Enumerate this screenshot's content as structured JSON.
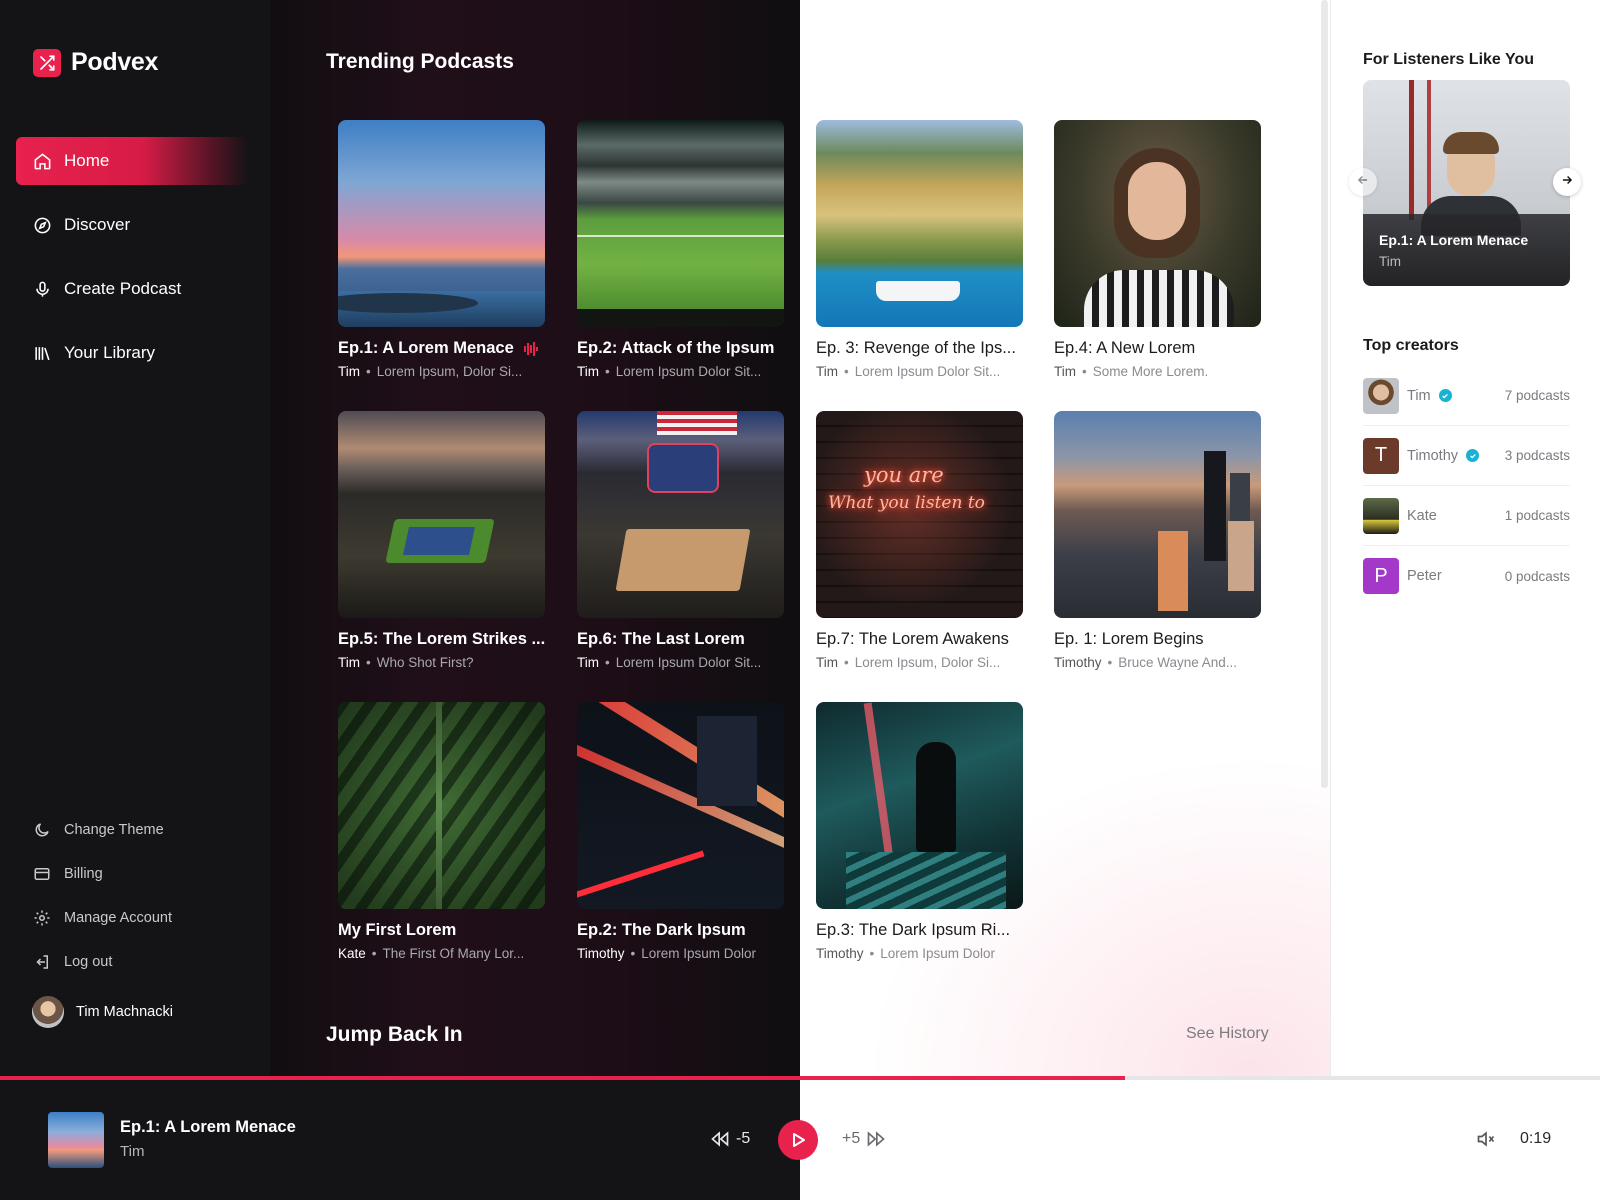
{
  "app": {
    "name": "Podvex"
  },
  "sidebar": {
    "nav": [
      {
        "label": "Home",
        "icon": "home-icon",
        "active": true
      },
      {
        "label": "Discover",
        "icon": "compass-icon",
        "active": false
      },
      {
        "label": "Create Podcast",
        "icon": "microphone-icon",
        "active": false
      },
      {
        "label": "Your Library",
        "icon": "library-icon",
        "active": false
      }
    ],
    "secondary": [
      {
        "label": "Change Theme",
        "icon": "moon-icon"
      },
      {
        "label": "Billing",
        "icon": "credit-card-icon"
      },
      {
        "label": "Manage Account",
        "icon": "gear-icon"
      },
      {
        "label": "Log out",
        "icon": "logout-icon"
      }
    ],
    "user": {
      "name": "Tim Machnacki"
    }
  },
  "main": {
    "trending_title": "Trending Podcasts",
    "jump_back_title": "Jump Back In",
    "see_history": "See History",
    "cards": [
      {
        "title": "Ep.1: A Lorem Menace",
        "author": "Tim",
        "desc": "Lorem Ipsum, Dolor Si...",
        "playing": true,
        "art": "sunset-sea"
      },
      {
        "title": "Ep.2: Attack of the Ipsum",
        "author": "Tim",
        "desc": "Lorem Ipsum Dolor Sit...",
        "playing": false,
        "art": "stadium"
      },
      {
        "title": "Ep. 3: Revenge of the Ips...",
        "author": "Tim",
        "desc": "Lorem Ipsum Dolor Sit...",
        "playing": false,
        "art": "coastal-village"
      },
      {
        "title": "Ep.4: A New Lorem",
        "author": "Tim",
        "desc": "Some More Lorem.",
        "playing": false,
        "art": "portrait"
      },
      {
        "title": "Ep.5: The Lorem Strikes ...",
        "author": "Tim",
        "desc": "Who Shot First?",
        "playing": false,
        "art": "tennis"
      },
      {
        "title": "Ep.6: The Last Lorem",
        "author": "Tim",
        "desc": "Lorem Ipsum Dolor Sit...",
        "playing": false,
        "art": "basketball-arena"
      },
      {
        "title": "Ep.7: The Lorem Awakens",
        "author": "Tim",
        "desc": "Lorem Ipsum, Dolor Si...",
        "playing": false,
        "art": "neon-sign"
      },
      {
        "title": "Ep. 1: Lorem Begins",
        "author": "Timothy",
        "desc": "Bruce Wayne And...",
        "playing": false,
        "art": "city-aerial"
      },
      {
        "title": "My First Lorem",
        "author": "Kate",
        "desc": "The First Of Many Lor...",
        "playing": false,
        "art": "fern"
      },
      {
        "title": "Ep.2: The Dark Ipsum",
        "author": "Timothy",
        "desc": "Lorem Ipsum Dolor",
        "playing": false,
        "art": "light-trails"
      },
      {
        "title": "Ep.3: The Dark Ipsum Ri...",
        "author": "Timothy",
        "desc": "Lorem Ipsum Dolor",
        "playing": false,
        "art": "subway-escalator"
      }
    ],
    "neon_text": [
      "you are",
      "What you listen to"
    ]
  },
  "right_panel": {
    "for_you_title": "For Listeners Like You",
    "feature": {
      "title": "Ep.1: A Lorem Menace",
      "author": "Tim"
    },
    "top_creators_title": "Top creators",
    "creators": [
      {
        "name": "Tim",
        "verified": true,
        "count": "7 podcasts",
        "avatar_color": "#b7b9bd",
        "initial": ""
      },
      {
        "name": "Timothy",
        "verified": true,
        "count": "3 podcasts",
        "avatar_color": "#6b3a2a",
        "initial": "T"
      },
      {
        "name": "Kate",
        "verified": false,
        "count": "1 podcasts",
        "avatar_color": "#7a7f5a",
        "initial": ""
      },
      {
        "name": "Peter",
        "verified": false,
        "count": "0 podcasts",
        "avatar_color": "#a438c9",
        "initial": "P"
      }
    ]
  },
  "player": {
    "title": "Ep.1: A Lorem Menace",
    "author": "Tim",
    "rewind_label": "-5",
    "forward_label": "+5",
    "time": "0:19",
    "progress": 0.703
  },
  "colors": {
    "accent": "#e8214d",
    "sidebar_bg": "#141416",
    "verified": "#17b3d4"
  }
}
